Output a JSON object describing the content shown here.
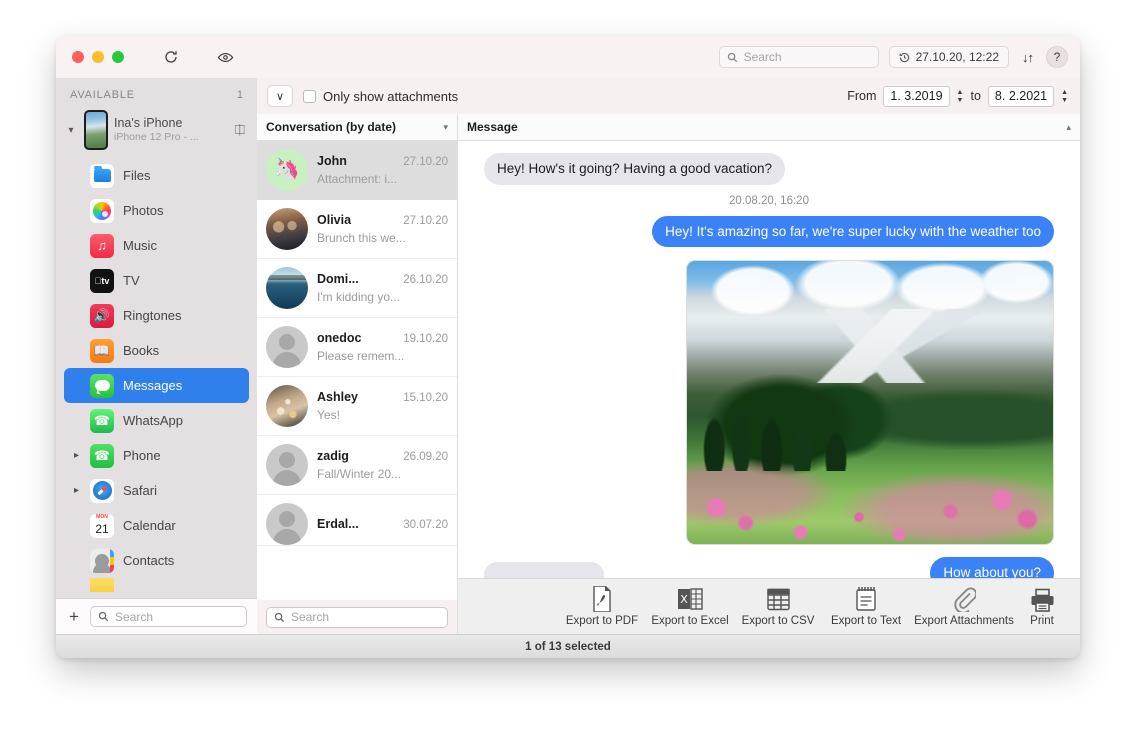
{
  "titlebar": {
    "refresh_icon": "refresh-icon",
    "eye_icon": "eye-icon",
    "search_placeholder": "Search",
    "history_timestamp": "27.10.20, 12:22",
    "sync_arrows": "↓↑",
    "help_label": "?"
  },
  "sidebar": {
    "section_label": "AVAILABLE",
    "section_count": "1",
    "device": {
      "name": "Ina's iPhone",
      "model": "iPhone 12 Pro - ..."
    },
    "apps": [
      {
        "label": "Files",
        "icon": "files-icon",
        "expandable": false,
        "selected": false
      },
      {
        "label": "Photos",
        "icon": "photos-icon",
        "expandable": false,
        "selected": false
      },
      {
        "label": "Music",
        "icon": "music-icon",
        "expandable": false,
        "selected": false
      },
      {
        "label": "TV",
        "icon": "tv-icon",
        "expandable": false,
        "selected": false
      },
      {
        "label": "Ringtones",
        "icon": "ringtones-icon",
        "expandable": false,
        "selected": false
      },
      {
        "label": "Books",
        "icon": "books-icon",
        "expandable": false,
        "selected": false
      },
      {
        "label": "Messages",
        "icon": "messages-icon",
        "expandable": false,
        "selected": true
      },
      {
        "label": "WhatsApp",
        "icon": "whatsapp-icon",
        "expandable": false,
        "selected": false
      },
      {
        "label": "Phone",
        "icon": "phone-icon",
        "expandable": true,
        "selected": false
      },
      {
        "label": "Safari",
        "icon": "safari-icon",
        "expandable": true,
        "selected": false
      },
      {
        "label": "Calendar",
        "icon": "calendar-icon",
        "expandable": false,
        "selected": false
      },
      {
        "label": "Contacts",
        "icon": "contacts-icon",
        "expandable": false,
        "selected": false
      }
    ],
    "add_label": "+",
    "search_placeholder": "Search"
  },
  "filterbar": {
    "collapse_label": "∨",
    "attachments_label": "Only show attachments",
    "attachments_checked": false,
    "from_label": "From",
    "from_date": "1.  3.2019",
    "to_label": "to",
    "to_date": "8.  2.2021"
  },
  "conversation_column": {
    "header": "Conversation (by date)",
    "search_placeholder": "Search",
    "items": [
      {
        "name": "John",
        "date": "27.10.20",
        "preview": "Attachment: i...",
        "avatar": "unicorn-avatar",
        "selected": true
      },
      {
        "name": "Olivia",
        "date": "27.10.20",
        "preview": "Brunch this we...",
        "avatar": "photo-avatar",
        "selected": false
      },
      {
        "name": "Domi...",
        "date": "26.10.20",
        "preview": "I'm kidding yo...",
        "avatar": "ocean-avatar",
        "selected": false
      },
      {
        "name": "onedoc",
        "date": "19.10.20",
        "preview": "Please remem...",
        "avatar": "default-avatar",
        "selected": false
      },
      {
        "name": "Ashley",
        "date": "15.10.20",
        "preview": "Yes!",
        "avatar": "table-avatar",
        "selected": false
      },
      {
        "name": "zadig",
        "date": "26.09.20",
        "preview": "Fall/Winter 20...",
        "avatar": "default-avatar",
        "selected": false
      },
      {
        "name": "Erdal...",
        "date": "30.07.20",
        "preview": "",
        "avatar": "default-avatar",
        "selected": false
      }
    ]
  },
  "message_column": {
    "header": "Message",
    "collapse_icon": "chevron-up-icon",
    "bubbles": [
      {
        "text": "Hey! How's it going? Having a good vacation?",
        "side": "in"
      },
      {
        "text": "Hey! It's amazing so far, we're super lucky with the weather too",
        "side": "out"
      },
      {
        "text": "How about you?",
        "side": "out"
      }
    ],
    "timestamp": "20.08.20, 16:20",
    "attachment": "alpine-mountain-photo"
  },
  "export_bar": {
    "items": [
      {
        "label": "Export to PDF",
        "icon": "pdf-icon"
      },
      {
        "label": "Export to Excel",
        "icon": "excel-icon"
      },
      {
        "label": "Export to CSV",
        "icon": "csv-icon"
      },
      {
        "label": "Export to Text",
        "icon": "text-icon"
      },
      {
        "label": "Export Attachments",
        "icon": "paperclip-icon"
      },
      {
        "label": "Print",
        "icon": "printer-icon"
      }
    ]
  },
  "statusbar": {
    "text": "1 of 13 selected"
  },
  "colors": {
    "accent": "#3b82f6",
    "sidebar_selected": "#2f80ed",
    "window_bg": "#f7f0f1",
    "sidebar_bg": "#e4dfe0"
  }
}
